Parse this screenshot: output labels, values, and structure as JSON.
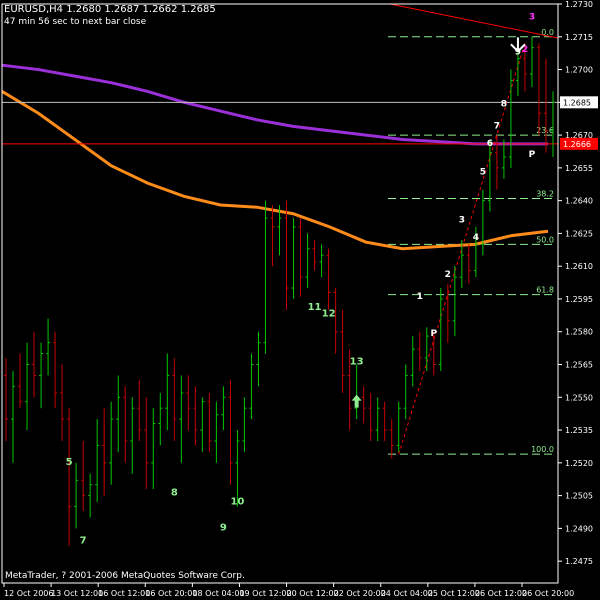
{
  "header": {
    "symbol_line": "EURUSD,H4  1.2680 1.2687 1.2662 1.2685",
    "timer_line": "47 min 56 sec to next bar close"
  },
  "footer": {
    "copyright": "MetaTrader, ? 2001-2006 MetaQuotes Software Corp."
  },
  "colors": {
    "background": "#000000",
    "bull_bar": "#00c800",
    "bear_bar": "#c80000",
    "ma_slow": "#9b30d9",
    "ma_fast": "#ff8c1a",
    "fib": "#90ee90",
    "wave_label": "#90ee90",
    "axis": "#ffffff",
    "bid_line": "#c0c0c0",
    "ask_line": "#ff0000",
    "ask_tag_bg": "#ff0000"
  },
  "chart_data": {
    "type": "candlestick-bar",
    "symbol": "EURUSD",
    "timeframe": "H4",
    "ylim": [
      1.2465,
      1.273
    ],
    "y_ticks": [
      "1.2730",
      "1.2715",
      "1.2700",
      "1.2685",
      "1.2670",
      "1.2655",
      "1.2640",
      "1.2625",
      "1.2610",
      "1.2595",
      "1.2580",
      "1.2565",
      "1.2550",
      "1.2535",
      "1.2520",
      "1.2505",
      "1.2490",
      "1.2475"
    ],
    "x_ticks": [
      "12 Oct 2006",
      "13 Oct 12:00",
      "16 Oct 12:00",
      "16 Oct 20:00",
      "18 Oct 04:00",
      "19 Oct 12:00",
      "20 Oct 12:00",
      "22 Oct 20:00",
      "24 Oct 04:00",
      "25 Oct 12:00",
      "26 Oct 12:00",
      "26 Oct 20:00"
    ],
    "current_price": "1.2685",
    "ask_price": "1.2666",
    "bars": [
      {
        "o": 1.256,
        "h": 1.2568,
        "l": 1.253,
        "c": 1.254
      },
      {
        "o": 1.254,
        "h": 1.2562,
        "l": 1.252,
        "c": 1.2555
      },
      {
        "o": 1.2555,
        "h": 1.257,
        "l": 1.2545,
        "c": 1.2548
      },
      {
        "o": 1.2548,
        "h": 1.2575,
        "l": 1.2535,
        "c": 1.2565
      },
      {
        "o": 1.2565,
        "h": 1.258,
        "l": 1.255,
        "c": 1.256
      },
      {
        "o": 1.256,
        "h": 1.2575,
        "l": 1.2545,
        "c": 1.257
      },
      {
        "o": 1.257,
        "h": 1.2586,
        "l": 1.256,
        "c": 1.2575
      },
      {
        "o": 1.2575,
        "h": 1.258,
        "l": 1.2545,
        "c": 1.2552
      },
      {
        "o": 1.2552,
        "h": 1.2565,
        "l": 1.253,
        "c": 1.254
      },
      {
        "o": 1.254,
        "h": 1.2545,
        "l": 1.2482,
        "c": 1.25
      },
      {
        "o": 1.25,
        "h": 1.252,
        "l": 1.249,
        "c": 1.2512
      },
      {
        "o": 1.2512,
        "h": 1.253,
        "l": 1.2498,
        "c": 1.2505
      },
      {
        "o": 1.2505,
        "h": 1.2515,
        "l": 1.2495,
        "c": 1.251
      },
      {
        "o": 1.251,
        "h": 1.254,
        "l": 1.2502,
        "c": 1.2528
      },
      {
        "o": 1.2528,
        "h": 1.2545,
        "l": 1.2505,
        "c": 1.252
      },
      {
        "o": 1.252,
        "h": 1.2548,
        "l": 1.251,
        "c": 1.254
      },
      {
        "o": 1.254,
        "h": 1.256,
        "l": 1.2525,
        "c": 1.255
      },
      {
        "o": 1.255,
        "h": 1.2555,
        "l": 1.252,
        "c": 1.253
      },
      {
        "o": 1.253,
        "h": 1.255,
        "l": 1.2515,
        "c": 1.2545
      },
      {
        "o": 1.2545,
        "h": 1.2558,
        "l": 1.253,
        "c": 1.2535
      },
      {
        "o": 1.2535,
        "h": 1.255,
        "l": 1.2508,
        "c": 1.252
      },
      {
        "o": 1.252,
        "h": 1.2545,
        "l": 1.2508,
        "c": 1.2538
      },
      {
        "o": 1.2538,
        "h": 1.2552,
        "l": 1.2528,
        "c": 1.2545
      },
      {
        "o": 1.2545,
        "h": 1.257,
        "l": 1.2535,
        "c": 1.256
      },
      {
        "o": 1.256,
        "h": 1.2568,
        "l": 1.253,
        "c": 1.254
      },
      {
        "o": 1.254,
        "h": 1.256,
        "l": 1.252,
        "c": 1.2552
      },
      {
        "o": 1.2552,
        "h": 1.256,
        "l": 1.2535,
        "c": 1.2545
      },
      {
        "o": 1.2545,
        "h": 1.2555,
        "l": 1.2528,
        "c": 1.2535
      },
      {
        "o": 1.2535,
        "h": 1.255,
        "l": 1.2525,
        "c": 1.2548
      },
      {
        "o": 1.2548,
        "h": 1.2552,
        "l": 1.2525,
        "c": 1.253
      },
      {
        "o": 1.253,
        "h": 1.2548,
        "l": 1.252,
        "c": 1.2542
      },
      {
        "o": 1.2542,
        "h": 1.2555,
        "l": 1.2535,
        "c": 1.255
      },
      {
        "o": 1.255,
        "h": 1.2558,
        "l": 1.251,
        "c": 1.252
      },
      {
        "o": 1.252,
        "h": 1.2535,
        "l": 1.25,
        "c": 1.253
      },
      {
        "o": 1.253,
        "h": 1.255,
        "l": 1.2525,
        "c": 1.2545
      },
      {
        "o": 1.2545,
        "h": 1.257,
        "l": 1.254,
        "c": 1.2565
      },
      {
        "o": 1.2565,
        "h": 1.258,
        "l": 1.2555,
        "c": 1.2575
      },
      {
        "o": 1.2575,
        "h": 1.264,
        "l": 1.257,
        "c": 1.2632
      },
      {
        "o": 1.2632,
        "h": 1.2638,
        "l": 1.261,
        "c": 1.2628
      },
      {
        "o": 1.2628,
        "h": 1.2638,
        "l": 1.2615,
        "c": 1.2632
      },
      {
        "o": 1.2632,
        "h": 1.264,
        "l": 1.259,
        "c": 1.26
      },
      {
        "o": 1.26,
        "h": 1.2632,
        "l": 1.2595,
        "c": 1.2628
      },
      {
        "o": 1.2628,
        "h": 1.2632,
        "l": 1.2596,
        "c": 1.2605
      },
      {
        "o": 1.2605,
        "h": 1.2625,
        "l": 1.26,
        "c": 1.2618
      },
      {
        "o": 1.2618,
        "h": 1.2622,
        "l": 1.2608,
        "c": 1.2612
      },
      {
        "o": 1.2612,
        "h": 1.262,
        "l": 1.2605,
        "c": 1.2615
      },
      {
        "o": 1.2615,
        "h": 1.2618,
        "l": 1.259,
        "c": 1.2598
      },
      {
        "o": 1.2598,
        "h": 1.26,
        "l": 1.257,
        "c": 1.258
      },
      {
        "o": 1.258,
        "h": 1.259,
        "l": 1.2552,
        "c": 1.256
      },
      {
        "o": 1.256,
        "h": 1.2572,
        "l": 1.2535,
        "c": 1.2545
      },
      {
        "o": 1.2545,
        "h": 1.2565,
        "l": 1.254,
        "c": 1.255
      },
      {
        "o": 1.255,
        "h": 1.2555,
        "l": 1.2538,
        "c": 1.2545
      },
      {
        "o": 1.2545,
        "h": 1.2552,
        "l": 1.253,
        "c": 1.2535
      },
      {
        "o": 1.2535,
        "h": 1.255,
        "l": 1.253,
        "c": 1.2545
      },
      {
        "o": 1.2545,
        "h": 1.2548,
        "l": 1.253,
        "c": 1.2535
      },
      {
        "o": 1.2535,
        "h": 1.254,
        "l": 1.2522,
        "c": 1.2528
      },
      {
        "o": 1.2528,
        "h": 1.2548,
        "l": 1.2525,
        "c": 1.2545
      },
      {
        "o": 1.2545,
        "h": 1.2565,
        "l": 1.254,
        "c": 1.256
      },
      {
        "o": 1.256,
        "h": 1.2578,
        "l": 1.2555,
        "c": 1.2572
      },
      {
        "o": 1.2572,
        "h": 1.258,
        "l": 1.2562,
        "c": 1.2568
      },
      {
        "o": 1.2568,
        "h": 1.2582,
        "l": 1.2562,
        "c": 1.2578
      },
      {
        "o": 1.2578,
        "h": 1.258,
        "l": 1.256,
        "c": 1.2565
      },
      {
        "o": 1.2565,
        "h": 1.26,
        "l": 1.2562,
        "c": 1.2595
      },
      {
        "o": 1.2595,
        "h": 1.2602,
        "l": 1.2575,
        "c": 1.2585
      },
      {
        "o": 1.2585,
        "h": 1.261,
        "l": 1.2578,
        "c": 1.2605
      },
      {
        "o": 1.2605,
        "h": 1.2622,
        "l": 1.26,
        "c": 1.2615
      },
      {
        "o": 1.2615,
        "h": 1.262,
        "l": 1.2602,
        "c": 1.2608
      },
      {
        "o": 1.2608,
        "h": 1.2628,
        "l": 1.2605,
        "c": 1.262
      },
      {
        "o": 1.262,
        "h": 1.2645,
        "l": 1.2615,
        "c": 1.264
      },
      {
        "o": 1.264,
        "h": 1.2668,
        "l": 1.2635,
        "c": 1.2662
      },
      {
        "o": 1.2662,
        "h": 1.267,
        "l": 1.2645,
        "c": 1.2655
      },
      {
        "o": 1.2655,
        "h": 1.2668,
        "l": 1.265,
        "c": 1.266
      },
      {
        "o": 1.266,
        "h": 1.27,
        "l": 1.2655,
        "c": 1.2695
      },
      {
        "o": 1.2695,
        "h": 1.271,
        "l": 1.2688,
        "c": 1.2705
      },
      {
        "o": 1.2705,
        "h": 1.2712,
        "l": 1.269,
        "c": 1.2698
      },
      {
        "o": 1.2698,
        "h": 1.2715,
        "l": 1.2692,
        "c": 1.271
      },
      {
        "o": 1.271,
        "h": 1.2712,
        "l": 1.267,
        "c": 1.268
      },
      {
        "o": 1.268,
        "h": 1.2705,
        "l": 1.2662,
        "c": 1.2672
      },
      {
        "o": 1.2672,
        "h": 1.269,
        "l": 1.266,
        "c": 1.2685
      }
    ],
    "ma_slow": [
      1.2702,
      1.27,
      1.2697,
      1.2694,
      1.269,
      1.2685,
      1.2681,
      1.2677,
      1.2674,
      1.2672,
      1.267,
      1.2668,
      1.2667,
      1.2666,
      1.2666,
      1.2666
    ],
    "ma_fast": [
      1.269,
      1.268,
      1.2668,
      1.2656,
      1.2648,
      1.2642,
      1.2638,
      1.2637,
      1.2634,
      1.2628,
      1.2621,
      1.2618,
      1.2619,
      1.262,
      1.2624,
      1.2626
    ],
    "fib_levels": [
      {
        "label": "0.0",
        "price": 1.2715
      },
      {
        "label": "23.6",
        "price": 1.267
      },
      {
        "label": "38.2",
        "price": 1.2641
      },
      {
        "label": "50.0",
        "price": 1.262
      },
      {
        "label": "61.8",
        "price": 1.2597
      },
      {
        "label": "100.0",
        "price": 1.2524
      }
    ],
    "wave_labels": [
      {
        "text": "5",
        "bar": 9,
        "price": 1.2519
      },
      {
        "text": "7",
        "bar": 11,
        "price": 1.2483
      },
      {
        "text": "8",
        "bar": 24,
        "price": 1.2505
      },
      {
        "text": "9",
        "bar": 31,
        "price": 1.2489
      },
      {
        "text": "10",
        "bar": 33,
        "price": 1.2501
      },
      {
        "text": "11",
        "bar": 44,
        "price": 1.259
      },
      {
        "text": "12",
        "bar": 46,
        "price": 1.2587
      },
      {
        "text": "13",
        "bar": 50,
        "price": 1.2565
      }
    ],
    "impulse_labels": [
      {
        "text": "1",
        "bar": 59,
        "price": 1.2595
      },
      {
        "text": "P",
        "bar": 61,
        "price": 1.2578
      },
      {
        "text": "2",
        "bar": 63,
        "price": 1.2605
      },
      {
        "text": "3",
        "bar": 65,
        "price": 1.263
      },
      {
        "text": "4",
        "bar": 67,
        "price": 1.2622
      },
      {
        "text": "5",
        "bar": 68,
        "price": 1.2652
      },
      {
        "text": "6",
        "bar": 69,
        "price": 1.2665
      },
      {
        "text": "7",
        "bar": 70,
        "price": 1.2673
      },
      {
        "text": "8",
        "bar": 71,
        "price": 1.2683
      },
      {
        "text": "9",
        "bar": 73,
        "price": 1.2707
      },
      {
        "text": "P",
        "bar": 75,
        "price": 1.266
      }
    ],
    "magenta_labels": [
      {
        "text": "3",
        "bar": 75,
        "price": 1.2723
      },
      {
        "text": "2",
        "bar": 74,
        "price": 1.2708
      }
    ]
  }
}
